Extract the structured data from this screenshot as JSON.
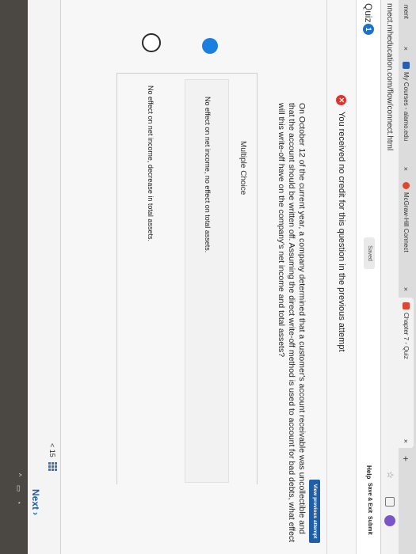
{
  "browser": {
    "tabs": [
      {
        "label": "ment",
        "close": "×"
      },
      {
        "label": "My Courses - alamo.edu",
        "close": "×"
      },
      {
        "label": "McGraw-Hill Connect",
        "close": "×"
      },
      {
        "label": "Chapter 7 - Quiz",
        "close": "×"
      }
    ],
    "new_tab": "+",
    "url": "nnect.mheducation.com/flow/connect.html"
  },
  "header": {
    "title": "Quiz",
    "question_number": "1",
    "saved": "Saved",
    "help": "Help",
    "save_exit": "Save & Exit",
    "submit": "Submit"
  },
  "notice": {
    "icon": "x-circle-icon",
    "text": "You received no credit for this question in the previous attempt"
  },
  "view_previous": "View previous attempt",
  "question": {
    "text": "On October 12 of the current year, a company determined that a customer's account receivable was uncollectible and that the account should be written off. Assuming the direct write-off method is used to account for bad debts, what effect will this write-off have on the company's net income and total assets?"
  },
  "choices": {
    "type_label": "Multiple Choice",
    "options": [
      {
        "text": "No effect on net income, no effect on total assets.",
        "selected": true
      },
      {
        "text": "No effect on net income, decrease in total assets.",
        "selected": false
      }
    ]
  },
  "footer": {
    "page_prefix": "< 15",
    "next": "Next",
    "next_chevron": "›"
  },
  "colors": {
    "accent": "#1b7fe0",
    "error": "#e0332f",
    "primary_button": "#1f5fa8"
  }
}
